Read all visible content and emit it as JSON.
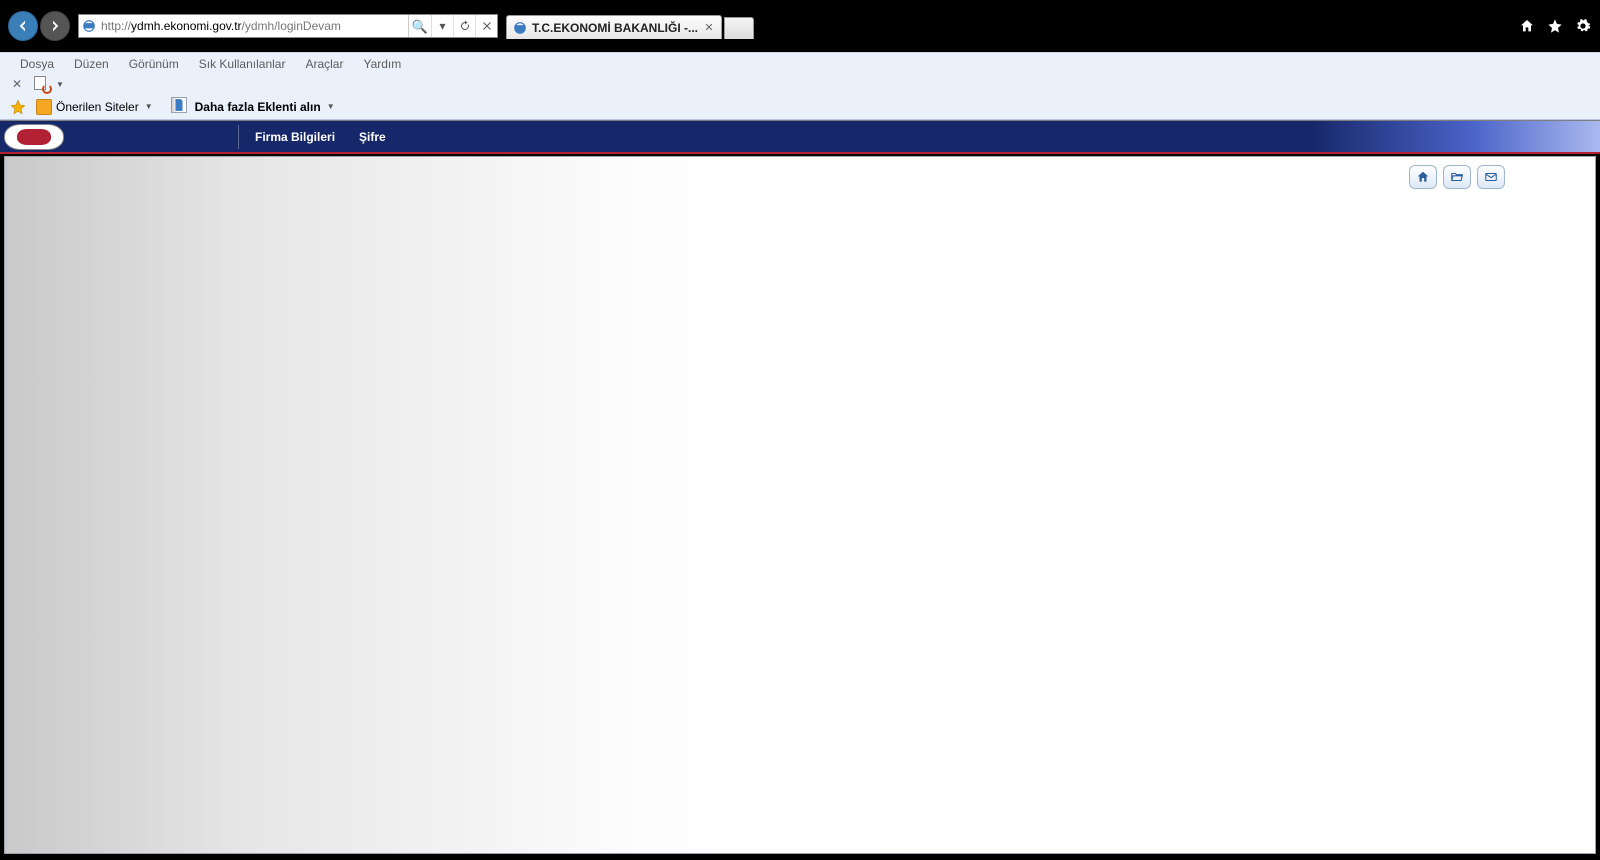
{
  "browser": {
    "url_prefix": "http://",
    "url_host": "ydmh.ekonomi.gov.tr",
    "url_path": "/ydmh/loginDevam",
    "tab_title": "T.C.EKONOMİ BAKANLIĞI -...",
    "menus": [
      "Dosya",
      "Düzen",
      "Görünüm",
      "Sık Kullanılanlar",
      "Araçlar",
      "Yardım"
    ],
    "fav_links": [
      {
        "label": "Önerilen Siteler",
        "bold": false
      },
      {
        "label": "Daha fazla Eklenti alın",
        "bold": true
      }
    ]
  },
  "app": {
    "menu": [
      "Firma Bilgileri",
      "Şifre"
    ]
  }
}
